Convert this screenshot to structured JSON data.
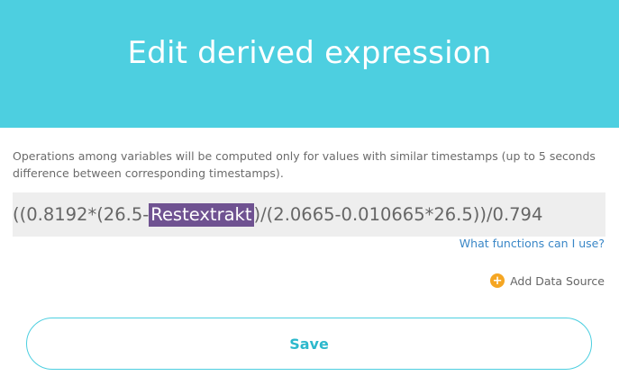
{
  "header": {
    "title": "Edit derived expression"
  },
  "note": "Operations among variables will be computed only for values with similar timestamps (up to 5 seconds difference between corresponding timestamps).",
  "expression": {
    "before": "((0.8192*(26.5-",
    "highlighted": "Restextrakt",
    "after": " )/(2.0665-0.010665*26.5))/0.794"
  },
  "help_link": "What functions can I use?",
  "add_data_source": {
    "label": "Add Data Source",
    "icon": "plus-circle-icon",
    "icon_color": "#f5a623"
  },
  "save_label": "Save",
  "colors": {
    "header_bg": "#4dcfe0",
    "highlight_bg": "#6f5291",
    "link": "#3a87c7",
    "save_text": "#2cb8cc"
  }
}
